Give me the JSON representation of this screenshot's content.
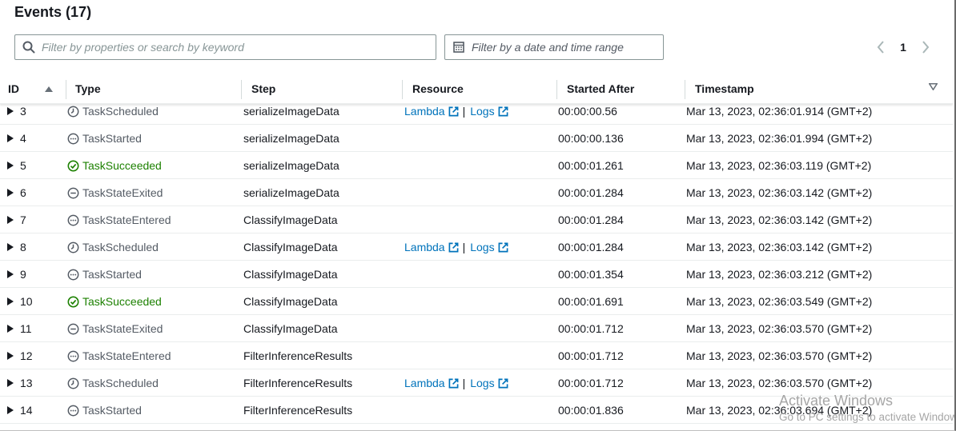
{
  "header": {
    "title": "Events",
    "count": "(17)"
  },
  "search": {
    "placeholder": "Filter by properties or search by keyword"
  },
  "date_filter": {
    "placeholder": "Filter by a date and time range"
  },
  "pagination": {
    "current_page": "1"
  },
  "columns": {
    "id": "ID",
    "type": "Type",
    "step": "Step",
    "resource": "Resource",
    "started_after": "Started After",
    "timestamp": "Timestamp"
  },
  "colors": {
    "link": "#0073bb",
    "success": "#1d8102",
    "neutral_icon": "#545b64"
  },
  "resource_links": {
    "lambda": "Lambda",
    "separator": "|",
    "logs": "Logs"
  },
  "rows": [
    {
      "id": "3",
      "type": "TaskScheduled",
      "icon": "clock-icon",
      "step": "serializeImageData",
      "has_resource": true,
      "started_after": "00:00:00.56",
      "timestamp": "Mar 13, 2023, 02:36:01.914 (GMT+2)"
    },
    {
      "id": "4",
      "type": "TaskStarted",
      "icon": "dots-circle-icon",
      "step": "serializeImageData",
      "has_resource": false,
      "started_after": "00:00:00.136",
      "timestamp": "Mar 13, 2023, 02:36:01.994 (GMT+2)"
    },
    {
      "id": "5",
      "type": "TaskSucceeded",
      "icon": "check-circle-icon",
      "step": "serializeImageData",
      "has_resource": false,
      "started_after": "00:00:01.261",
      "timestamp": "Mar 13, 2023, 02:36:03.119 (GMT+2)"
    },
    {
      "id": "6",
      "type": "TaskStateExited",
      "icon": "minus-circle-icon",
      "step": "serializeImageData",
      "has_resource": false,
      "started_after": "00:00:01.284",
      "timestamp": "Mar 13, 2023, 02:36:03.142 (GMT+2)"
    },
    {
      "id": "7",
      "type": "TaskStateEntered",
      "icon": "dots-circle-icon",
      "step": "ClassifyImageData",
      "has_resource": false,
      "started_after": "00:00:01.284",
      "timestamp": "Mar 13, 2023, 02:36:03.142 (GMT+2)"
    },
    {
      "id": "8",
      "type": "TaskScheduled",
      "icon": "clock-icon",
      "step": "ClassifyImageData",
      "has_resource": true,
      "started_after": "00:00:01.284",
      "timestamp": "Mar 13, 2023, 02:36:03.142 (GMT+2)"
    },
    {
      "id": "9",
      "type": "TaskStarted",
      "icon": "dots-circle-icon",
      "step": "ClassifyImageData",
      "has_resource": false,
      "started_after": "00:00:01.354",
      "timestamp": "Mar 13, 2023, 02:36:03.212 (GMT+2)"
    },
    {
      "id": "10",
      "type": "TaskSucceeded",
      "icon": "check-circle-icon",
      "step": "ClassifyImageData",
      "has_resource": false,
      "started_after": "00:00:01.691",
      "timestamp": "Mar 13, 2023, 02:36:03.549 (GMT+2)"
    },
    {
      "id": "11",
      "type": "TaskStateExited",
      "icon": "minus-circle-icon",
      "step": "ClassifyImageData",
      "has_resource": false,
      "started_after": "00:00:01.712",
      "timestamp": "Mar 13, 2023, 02:36:03.570 (GMT+2)"
    },
    {
      "id": "12",
      "type": "TaskStateEntered",
      "icon": "dots-circle-icon",
      "step": "FilterInferenceResults",
      "has_resource": false,
      "started_after": "00:00:01.712",
      "timestamp": "Mar 13, 2023, 02:36:03.570 (GMT+2)"
    },
    {
      "id": "13",
      "type": "TaskScheduled",
      "icon": "clock-icon",
      "step": "FilterInferenceResults",
      "has_resource": true,
      "started_after": "00:00:01.712",
      "timestamp": "Mar 13, 2023, 02:36:03.570 (GMT+2)"
    },
    {
      "id": "14",
      "type": "TaskStarted",
      "icon": "dots-circle-icon",
      "step": "FilterInferenceResults",
      "has_resource": false,
      "started_after": "00:00:01.836",
      "timestamp": "Mar 13, 2023, 02:36:03.694 (GMT+2)"
    }
  ],
  "watermark": {
    "line1": "Activate Windows",
    "line2": "Go to PC settings to activate Windows."
  }
}
